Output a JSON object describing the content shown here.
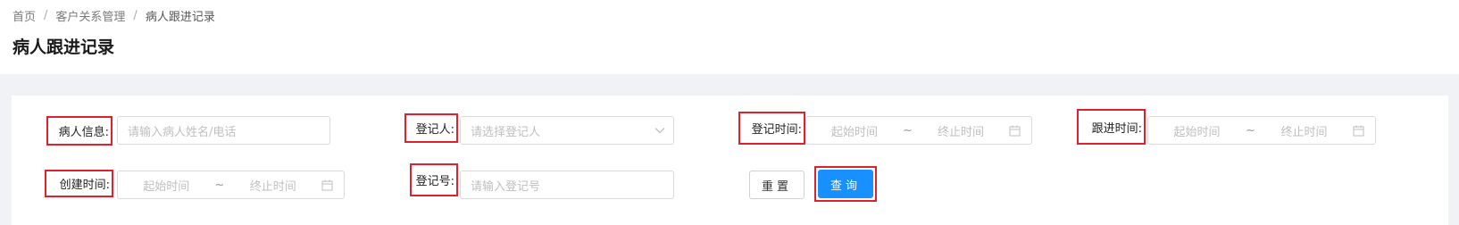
{
  "breadcrumb": {
    "items": [
      "首页",
      "客户关系管理",
      "病人跟进记录"
    ],
    "separator": "/"
  },
  "page": {
    "title": "病人跟进记录"
  },
  "filters": {
    "patient_info": {
      "label": "病人信息:",
      "placeholder": "请输入病人姓名/电话"
    },
    "registrar": {
      "label": "登记人:",
      "placeholder": "请选择登记人"
    },
    "register_time": {
      "label": "登记时间:",
      "start_placeholder": "起始时间",
      "separator": "~",
      "end_placeholder": "终止时间"
    },
    "followup_time": {
      "label": "跟进时间:",
      "start_placeholder": "起始时间",
      "separator": "~",
      "end_placeholder": "终止时间"
    },
    "create_time": {
      "label": "创建时间:",
      "start_placeholder": "起始时间",
      "separator": "~",
      "end_placeholder": "终止时间"
    },
    "register_no": {
      "label": "登记号:",
      "placeholder": "请输入登记号"
    }
  },
  "buttons": {
    "reset": "重置",
    "query": "查询"
  },
  "colors": {
    "primary": "#1890ff",
    "highlight": "#e0202e",
    "background": "#f0f2f5"
  }
}
